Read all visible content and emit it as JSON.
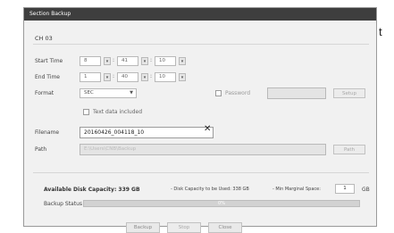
{
  "outside_text": "t",
  "dialog": {
    "title": "Section Backup",
    "channel": "CH 03",
    "start_time": {
      "label": "Start Time",
      "hour": "8",
      "minute": "41",
      "second": "10"
    },
    "end_time": {
      "label": "End Time",
      "hour": "1",
      "minute": "40",
      "second": "10"
    },
    "format": {
      "label": "Format",
      "value": "SEC",
      "arrow": "▼"
    },
    "password": {
      "label": "Password",
      "setup_label": "Setup"
    },
    "text_data": {
      "label": "Text data included"
    },
    "filename": {
      "label": "Filename",
      "value": "20160426_004118_10",
      "clear": "✕"
    },
    "path": {
      "label": "Path",
      "value": "E:\\Users\\CNB\\Backup",
      "button": "Path"
    },
    "disk": {
      "available_label": "Available Disk Capacity: 339 GB",
      "needed_label": "- Disk Capacity to be Used: 338 GB",
      "margin_label": "- Min Marginal Space:",
      "margin_value": "1",
      "margin_unit": "GB"
    },
    "status": {
      "label": "Backup Status",
      "percent": "0%",
      "progress": 0
    },
    "buttons": {
      "backup": "Backup",
      "stop": "Stop",
      "close": "Close"
    }
  }
}
